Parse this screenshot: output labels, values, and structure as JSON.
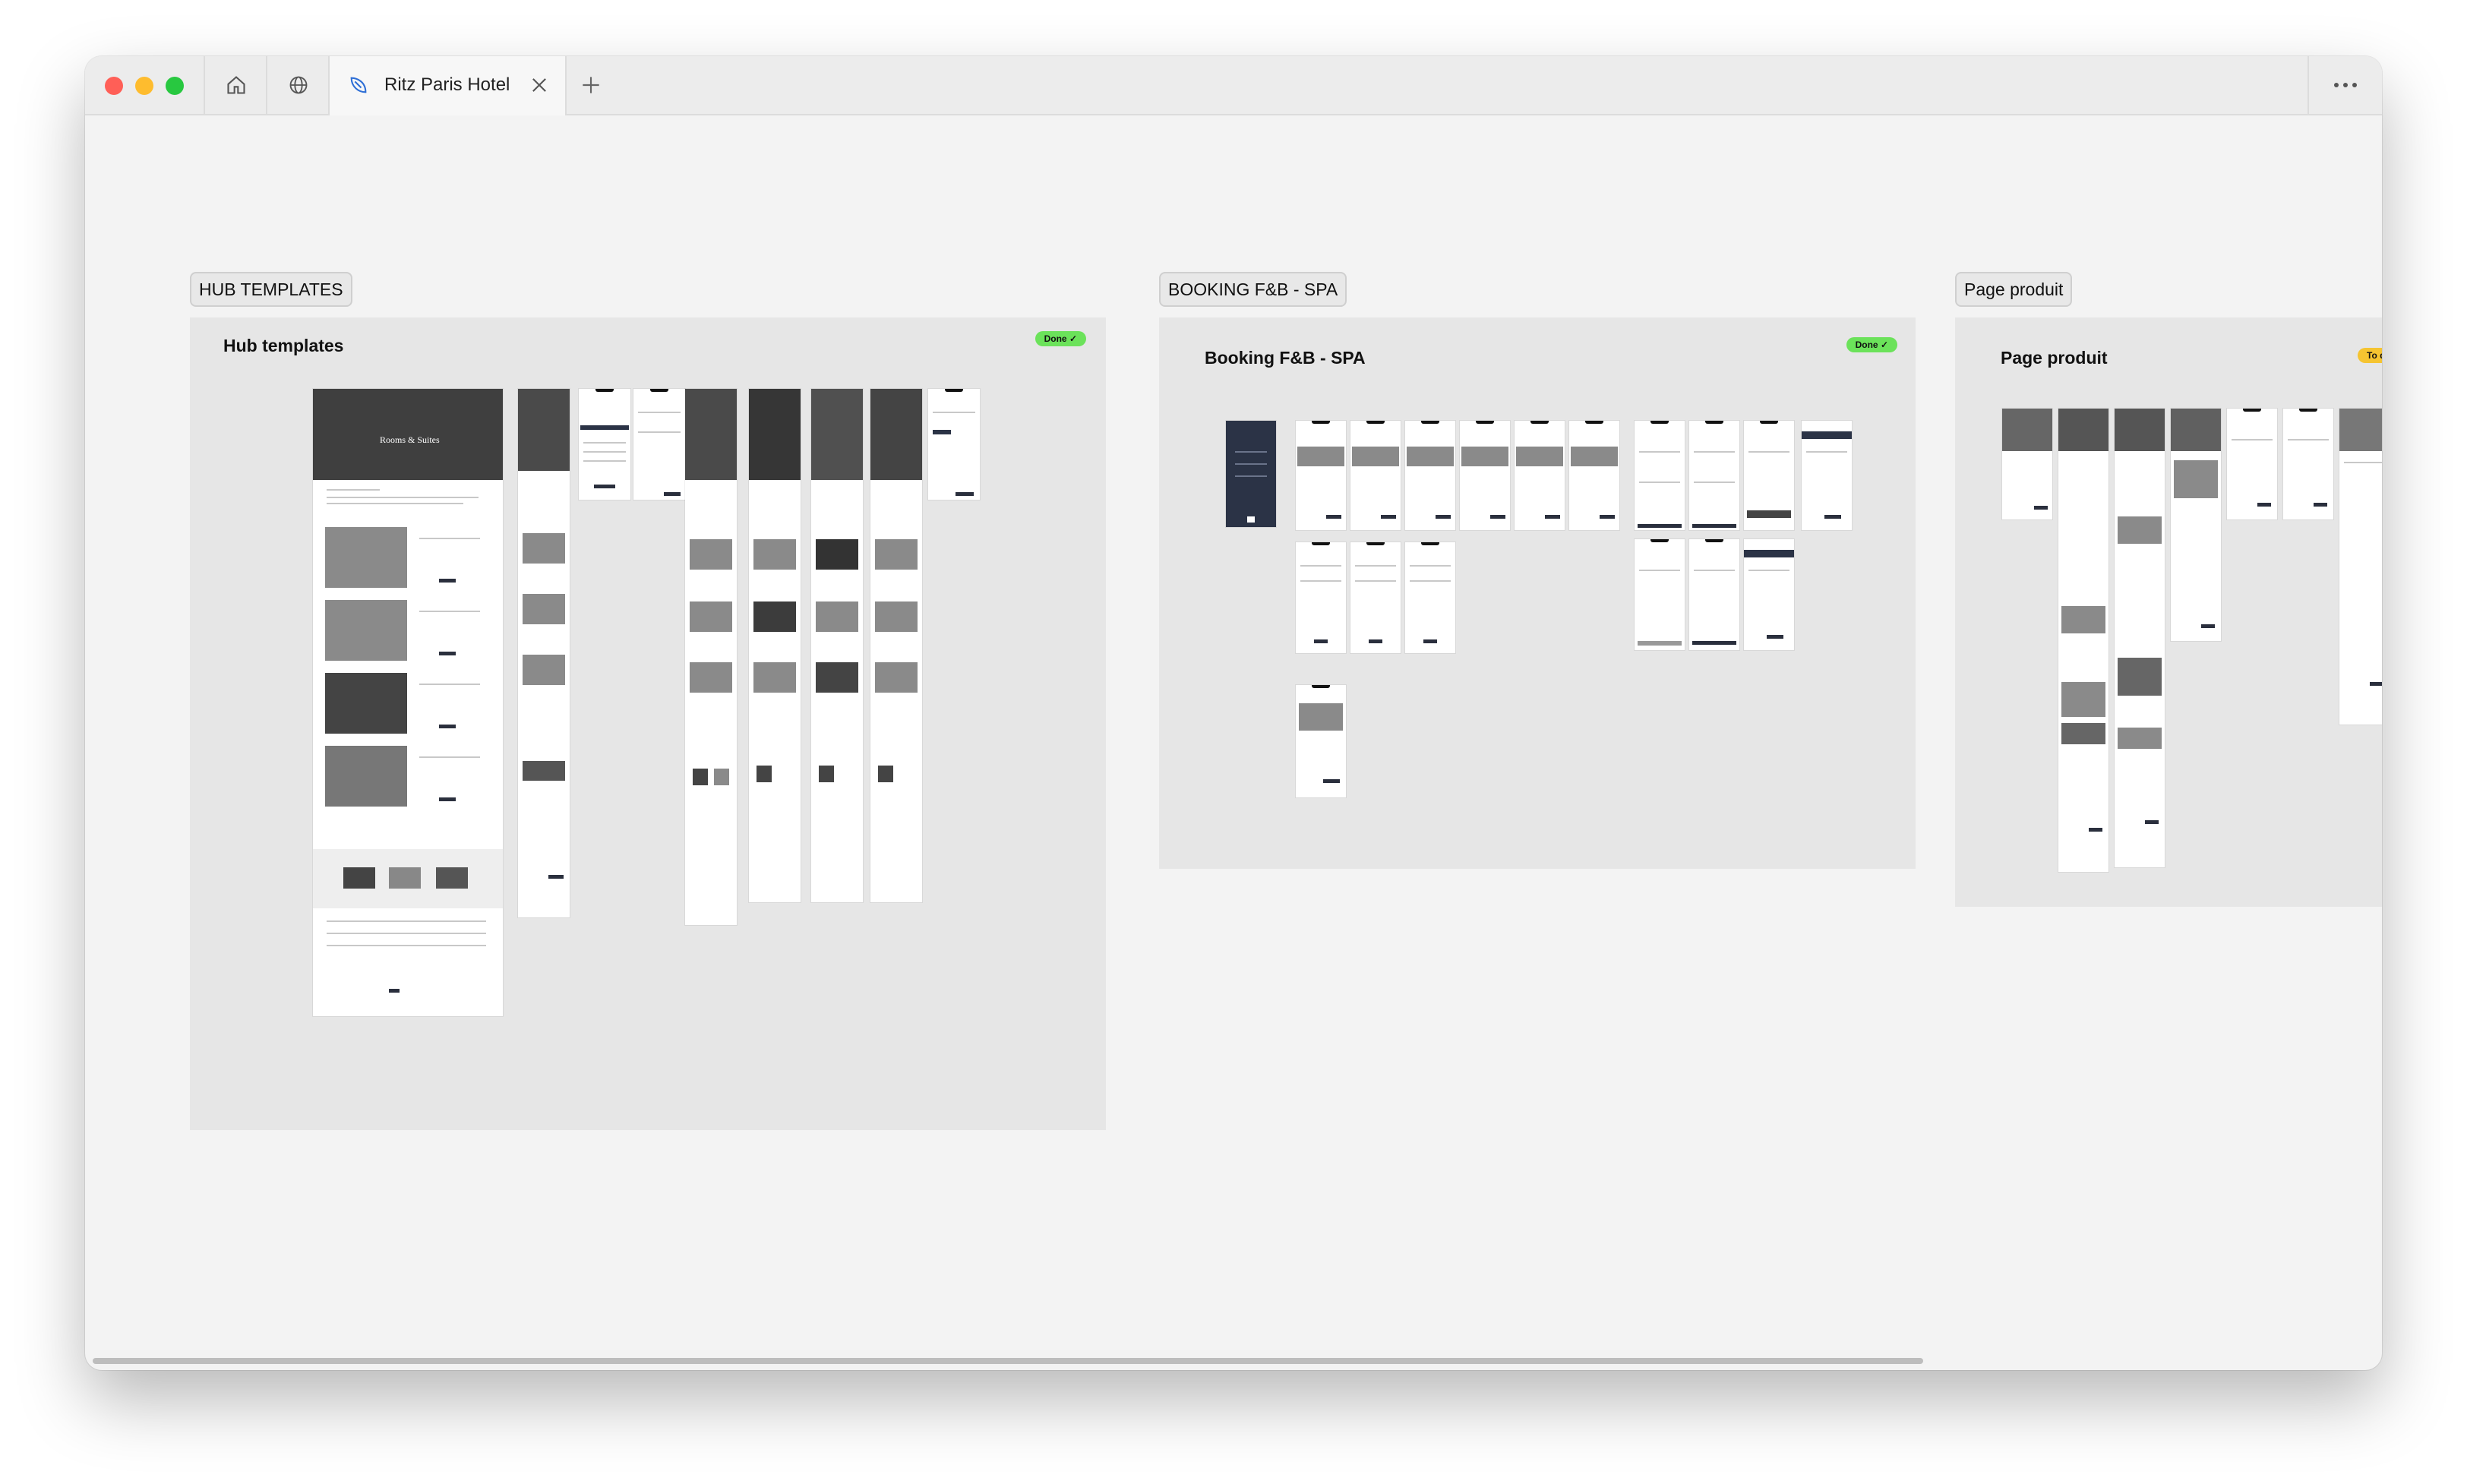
{
  "browser": {
    "tab_title": "Ritz Paris Hotel",
    "traffic_lights": [
      "#ff5f57",
      "#febc2e",
      "#28c840"
    ],
    "icons": [
      "home-icon",
      "globe-icon",
      "tab-logo-icon",
      "close-icon",
      "plus-icon",
      "more-icon"
    ]
  },
  "sections": [
    {
      "label": "HUB TEMPLATES",
      "title": "Hub templates",
      "status": "Done",
      "status_color": "#6be25a"
    },
    {
      "label": "BOOKING F&B - SPA",
      "title": "Booking F&B - SPA",
      "status": "Done",
      "status_color": "#6be25a"
    },
    {
      "label": "Page produit",
      "title": "Page produit",
      "status": "To do",
      "status_color": "#f5c431"
    }
  ],
  "thumbnail_text": {
    "rooms_hero": "Rooms & Suites"
  }
}
